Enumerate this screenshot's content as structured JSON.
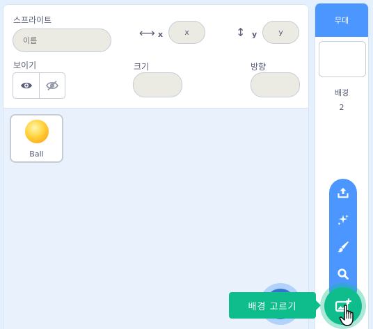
{
  "sprite_info": {
    "sprite_label": "스프라이트",
    "name_placeholder": "이름",
    "x_label": "x",
    "x_placeholder": "x",
    "y_label": "y",
    "y_placeholder": "y",
    "show_label": "보이기",
    "size_label": "크기",
    "direction_label": "방향"
  },
  "sprites": [
    {
      "name": "Ball"
    }
  ],
  "stage": {
    "header": "무대",
    "backdrops_label": "배경",
    "backdrops_count": "2"
  },
  "tooltip": {
    "choose_backdrop": "배경 고르기"
  },
  "backdrop_menu_icons": [
    "upload-icon",
    "surprise-icon",
    "paint-icon",
    "search-icon"
  ],
  "colors": {
    "accent_blue": "#4c97ff",
    "dark_blue": "#3373cc",
    "teal": "#0fbd8c",
    "text": "#575e75",
    "background": "#e5f0ff"
  }
}
